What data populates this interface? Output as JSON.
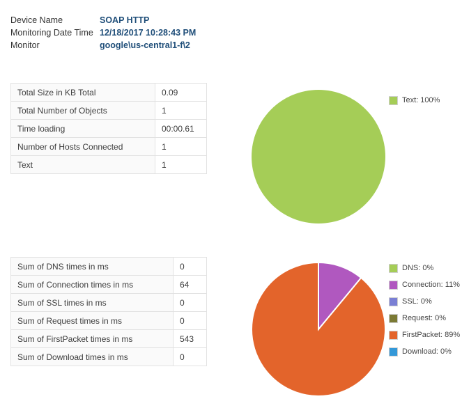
{
  "meta": {
    "rows": [
      {
        "label": "Device Name",
        "value": "SOAP HTTP"
      },
      {
        "label": "Monitoring Date Time",
        "value": "12/18/2017 10:28:43 PM"
      },
      {
        "label": "Monitor",
        "value": "google\\us-central1-f\\2"
      }
    ],
    "value_color": "#1f4e79"
  },
  "summary_table": {
    "rows": [
      {
        "label": "Total Size in KB Total",
        "value": "0.09"
      },
      {
        "label": "Total Number of Objects",
        "value": "1"
      },
      {
        "label": "Time loading",
        "value": "00:00.61"
      },
      {
        "label": "Number of Hosts Connected",
        "value": "1"
      },
      {
        "label": "Text",
        "value": "1"
      }
    ]
  },
  "timings_table": {
    "rows": [
      {
        "label": "Sum of DNS times in ms",
        "value": "0"
      },
      {
        "label": "Sum of Connection times in ms",
        "value": "64"
      },
      {
        "label": "Sum of SSL times in ms",
        "value": "0"
      },
      {
        "label": "Sum of Request times in ms",
        "value": "0"
      },
      {
        "label": "Sum of FirstPacket times in ms",
        "value": "543"
      },
      {
        "label": "Sum of Download times in ms",
        "value": "0"
      }
    ]
  },
  "chart_data": [
    {
      "type": "pie",
      "name": "content-composition-pie",
      "title": "",
      "legend_position": "right",
      "labels": [
        "Text"
      ],
      "values": [
        100
      ],
      "colors": [
        "#a5cd57"
      ],
      "legend_entries": [
        {
          "label": "Text: 100%",
          "color": "#a5cd57"
        }
      ]
    },
    {
      "type": "pie",
      "name": "timing-breakdown-pie",
      "title": "",
      "legend_position": "right",
      "labels": [
        "DNS",
        "Connection",
        "SSL",
        "Request",
        "FirstPacket",
        "Download"
      ],
      "values": [
        0,
        11,
        0,
        0,
        89,
        0
      ],
      "colors": [
        "#a5cd57",
        "#b058bf",
        "#7a7fd4",
        "#7b7a35",
        "#e3642b",
        "#3498d8"
      ],
      "legend_entries": [
        {
          "label": "DNS: 0%",
          "color": "#a5cd57"
        },
        {
          "label": "Connection: 11%",
          "color": "#b058bf"
        },
        {
          "label": "SSL: 0%",
          "color": "#7a7fd4"
        },
        {
          "label": "Request: 0%",
          "color": "#7b7a35"
        },
        {
          "label": "FirstPacket: 89%",
          "color": "#e3642b"
        },
        {
          "label": "Download: 0%",
          "color": "#3498d8"
        }
      ]
    }
  ]
}
